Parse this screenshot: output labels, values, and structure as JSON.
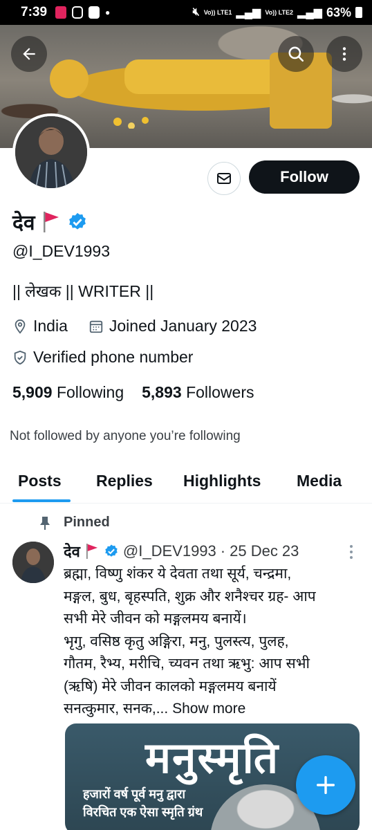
{
  "status_bar": {
    "time": "7:39",
    "battery": "63%",
    "network_1": "Vo)) LTE1",
    "network_2": "Vo)) LTE2"
  },
  "profile": {
    "display_name": "देव",
    "handle": "@I_DEV1993",
    "bio": "|| लेखक || WRITER ||",
    "location": "India",
    "joined": "Joined January 2023",
    "verified_phone": "Verified phone number",
    "following_count": "5,909",
    "following_label": "Following",
    "followers_count": "5,893",
    "followers_label": "Followers",
    "not_followed_text": "Not followed by anyone you’re following",
    "follow_label": "Follow"
  },
  "tabs": [
    {
      "label": "Posts",
      "active": true
    },
    {
      "label": "Replies",
      "active": false
    },
    {
      "label": "Highlights",
      "active": false
    },
    {
      "label": "Media",
      "active": false
    }
  ],
  "pinned_post": {
    "pinned_label": "Pinned",
    "author_name": "देव",
    "author_handle": "@I_DEV1993",
    "separator": "·",
    "date": "25 Dec 23",
    "text_lines": [
      "ब्रह्मा, विष्णु शंकर ये देवता तथा सूर्य, चन्द्रमा,",
      "मङ्गल, बुध, बृहस्पति, शुक्र और शनैश्चर ग्रह- आप",
      "सभी मेरे जीवन को मङ्गलमय बनायें।",
      "भृगु, वसिष्ठ कृतु अङ्गिरा, मनु, पुलस्त्य, पुलह,",
      "गौतम, रैभ्य, मरीचि, च्यवन तथा ऋभु: आप सभी",
      "(ऋषि) मेरे जीवन कालको मङ्गलमय बनायें",
      "सनत्कुमार, सनक,..."
    ],
    "show_more": "Show more",
    "image_title": "मनुस्मृति",
    "image_line_1": "हजारों वर्ष पूर्व मनु द्वारा",
    "image_line_2": "विरचित एक ऐसा स्मृति ग्रंथ"
  },
  "colors": {
    "accent": "#1d9bf0",
    "verified": "#1d9bf0",
    "follow_bg": "#0f1419",
    "flag_red": "#e0245e"
  },
  "icons": [
    "back-arrow-icon",
    "search-icon",
    "more-vertical-icon",
    "mail-icon",
    "verified-badge-icon",
    "flag-icon",
    "location-pin-icon",
    "calendar-icon",
    "shield-check-icon",
    "pin-icon",
    "plus-icon"
  ]
}
